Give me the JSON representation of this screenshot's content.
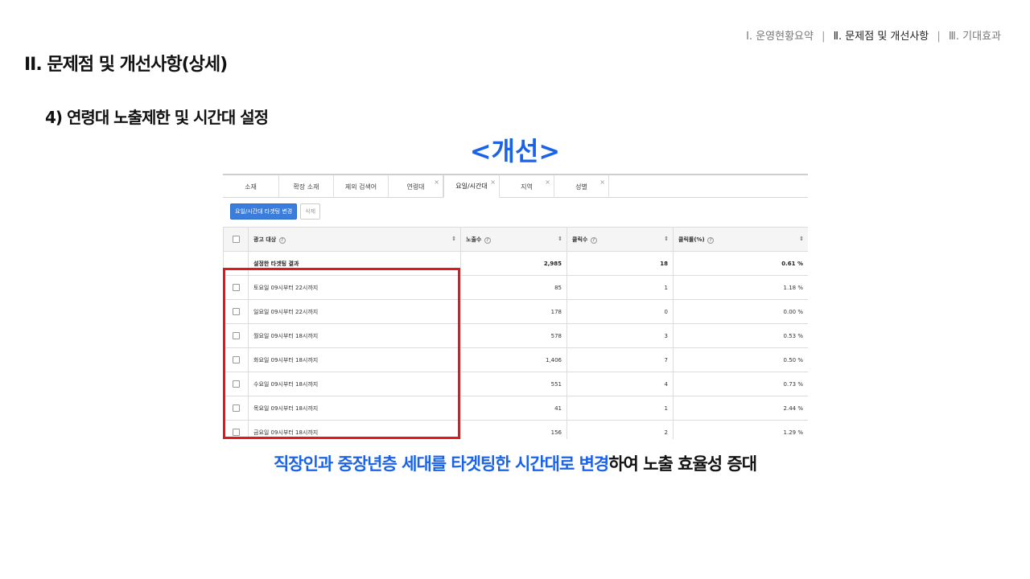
{
  "nav": {
    "item1": "Ⅰ. 운영현황요약",
    "item2": "Ⅱ. 문제점 및 개선사항",
    "item3": "Ⅲ. 기대효과",
    "sep": "|"
  },
  "section_title": "II. 문제점 및 개선사항(상세)",
  "sub_title": "4) 연령대 노출제한 및 시간대 설정",
  "highlight": "<개선>",
  "screenshot": {
    "tabs": [
      {
        "label": "소재",
        "closable": false
      },
      {
        "label": "확장 소재",
        "closable": false
      },
      {
        "label": "제외 검색어",
        "closable": false
      },
      {
        "label": "연령대",
        "closable": true
      },
      {
        "label": "요일/시간대",
        "closable": true,
        "active": true
      },
      {
        "label": "지역",
        "closable": true
      },
      {
        "label": "성별",
        "closable": true
      }
    ],
    "close_glyph": "×",
    "toolbar": {
      "change_button": "요일/시간대 타겟팅 변경",
      "delete_button": "삭제"
    },
    "columns": [
      "광고 대상",
      "노출수",
      "클릭수",
      "클릭률(%)"
    ],
    "help_glyph": "?",
    "sort_glyph": "⇕",
    "summary": {
      "label": "설정한 타겟팅 결과",
      "impressions": "2,985",
      "clicks": "18",
      "ctr": "0.61 %"
    },
    "rows": [
      {
        "label": "토요일 09시부터 22시까지",
        "impressions": "85",
        "clicks": "1",
        "ctr": "1.18 %"
      },
      {
        "label": "일요일 09시부터 22시까지",
        "impressions": "178",
        "clicks": "0",
        "ctr": "0.00 %"
      },
      {
        "label": "월요일 09시부터 18시까지",
        "impressions": "578",
        "clicks": "3",
        "ctr": "0.53 %"
      },
      {
        "label": "화요일 09시부터 18시까지",
        "impressions": "1,406",
        "clicks": "7",
        "ctr": "0.50 %"
      },
      {
        "label": "수요일 09시부터 18시까지",
        "impressions": "551",
        "clicks": "4",
        "ctr": "0.73 %"
      },
      {
        "label": "목요일 09시부터 18시까지",
        "impressions": "41",
        "clicks": "1",
        "ctr": "2.44 %"
      },
      {
        "label": "금요일 09시부터 18시까지",
        "impressions": "156",
        "clicks": "2",
        "ctr": "1.29 %"
      }
    ]
  },
  "caption": {
    "blue": "직장인과 중장년층 세대를 타겟팅한 시간대로 변경",
    "black": "하여 노출 효율성 증대"
  },
  "colors": {
    "accent": "#1a63e8",
    "highlight_box": "#e0191c",
    "button": "#3b7ddd"
  }
}
